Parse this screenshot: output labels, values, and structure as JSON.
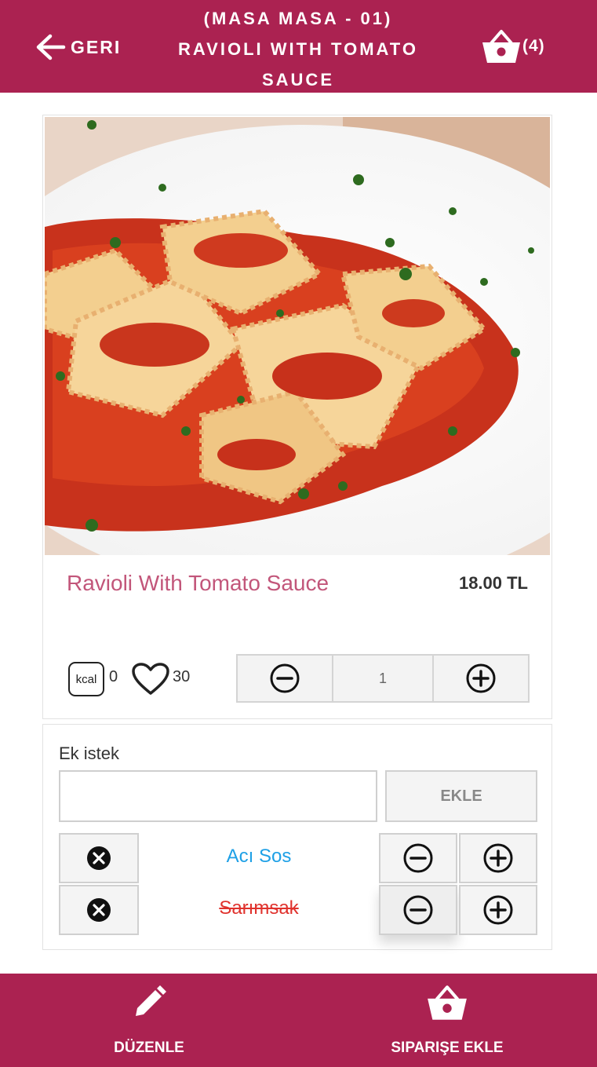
{
  "header": {
    "back_label": "GERI",
    "table": "(MASA MASA - 01)",
    "product_title": "RAVIOLI WITH TOMATO SAUCE",
    "cart_count": "(4)"
  },
  "product": {
    "name": "Ravioli With Tomato Sauce",
    "price": "18.00 TL",
    "kcal_label": "kcal",
    "kcal": "0",
    "likes": "30",
    "quantity": "1"
  },
  "extras": {
    "label": "Ek istek",
    "input_value": "",
    "input_placeholder": "",
    "add_button": "EKLE",
    "options": [
      {
        "name": "Acı Sos",
        "state": "active"
      },
      {
        "name": "Sarımsak",
        "state": "removed"
      }
    ]
  },
  "footer": {
    "edit_label": "DÜZENLE",
    "order_label": "SIPARIŞE EKLE"
  },
  "colors": {
    "brand": "#ab2251",
    "product_name": "#c2567a",
    "option_active": "#1ea0e6",
    "option_removed": "#e0322d"
  }
}
